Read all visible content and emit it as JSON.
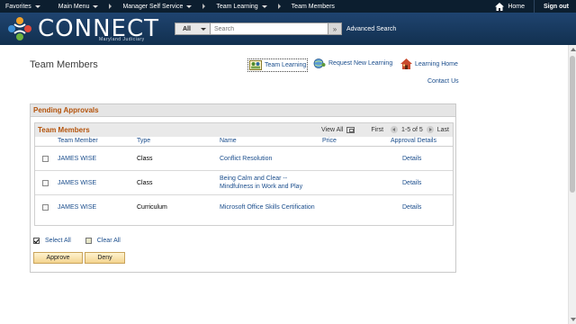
{
  "topnav": {
    "favorites": "Favorites",
    "main_menu": "Main Menu",
    "manager_self_service": "Manager Self Service",
    "team_learning": "Team Learning",
    "team_members": "Team Members",
    "home": "Home",
    "sign_out": "Sign out"
  },
  "header": {
    "brand": "CONNECT",
    "brand_sub": "Maryland Judiciary",
    "search_scope": "All",
    "search_placeholder": "Search",
    "advanced_search": "Advanced Search"
  },
  "page": {
    "title": "Team Members",
    "links": {
      "team_learning": "Team Learning",
      "request_new_learning": "Request New Learning",
      "learning_home": "Learning Home",
      "contact_us": "Contact Us"
    }
  },
  "pending": {
    "title": "Pending Approvals",
    "grid_title": "Team Members",
    "view_all": "View All",
    "first": "First",
    "range": "1-5 of 5",
    "last": "Last",
    "columns": {
      "member": "Team Member",
      "type": "Type",
      "name": "Name",
      "price": "Price",
      "details": "Approval Details"
    },
    "rows": [
      {
        "member": "JAMES WISE",
        "type": "Class",
        "name": "Conflict Resolution",
        "name2": "",
        "price": "",
        "details": "Details"
      },
      {
        "member": "JAMES WISE",
        "type": "Class",
        "name": "Being Calm and Clear --",
        "name2": "Mindfulness in Work and Play",
        "price": "",
        "details": "Details"
      },
      {
        "member": "JAMES WISE",
        "type": "Curriculum",
        "name": "Microsoft Office Skills Certification",
        "name2": "",
        "price": "",
        "details": "Details"
      }
    ],
    "select_all": "Select All",
    "clear_all": "Clear All",
    "approve": "Approve",
    "deny": "Deny"
  },
  "icons": {
    "home": "home-icon",
    "search_go": "double-chevron-right-icon",
    "team_learning": "team-learning-icon",
    "request_new_learning": "globe-people-icon",
    "learning_home": "house-icon"
  },
  "colors": {
    "topbar": "#0c1e2f",
    "header": "#1f4470",
    "section_title": "#b4530b",
    "link": "#1a4d8c",
    "button": "#f4d48f"
  }
}
